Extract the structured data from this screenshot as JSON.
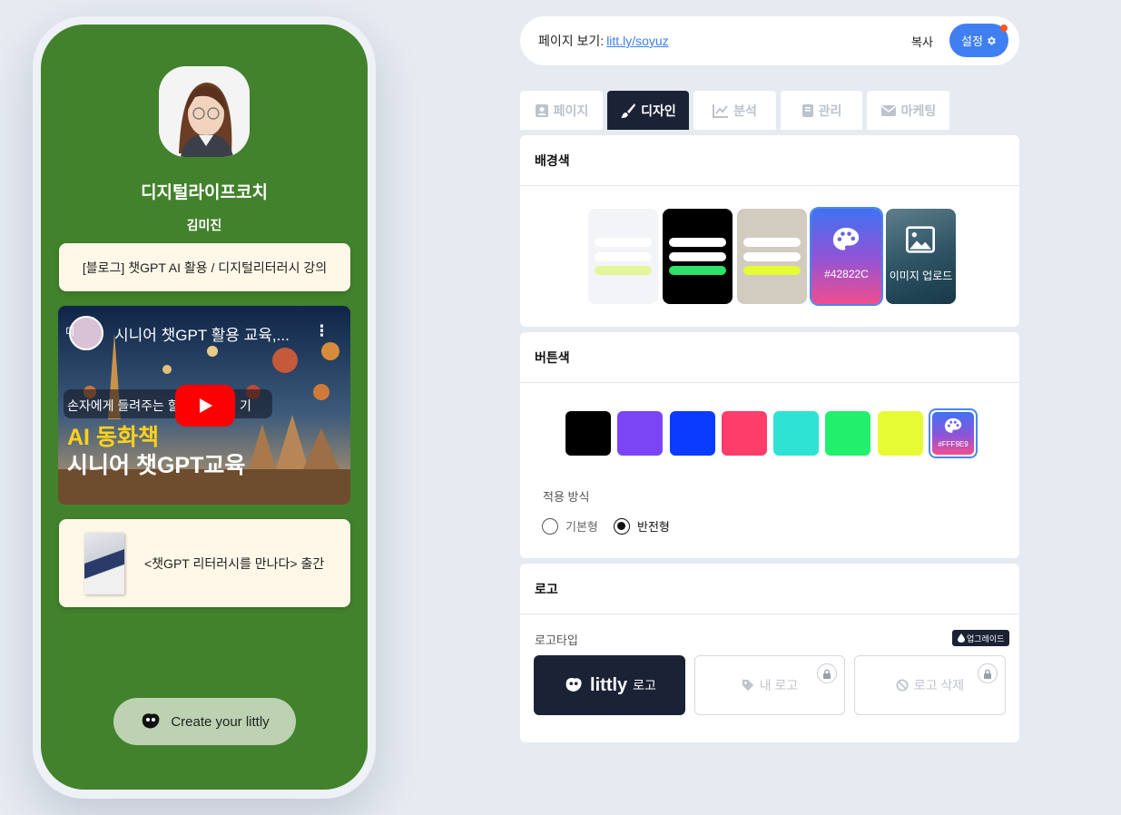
{
  "preview": {
    "title": "디지털라이프코치",
    "name": "김미진",
    "links": [
      {
        "label": "[블로그] 챗GPT AI 활용 / 디지털리터러시 강의"
      },
      {
        "label": "<챗GPT 리터러시를 만나다> 출간"
      }
    ],
    "video": {
      "title": "시니어 챗GPT 활용 교육,...",
      "channel_hint": "디",
      "subtitle": "손자에게 들려주는 할",
      "subtitle_tail": "기",
      "headline_1": "AI 동화책",
      "headline_2": "시니어 챗GPT교육"
    },
    "create_button": "Create your littly",
    "background_color": "#42822c"
  },
  "topbar": {
    "view_label": "페이지 보기:",
    "view_link": "litt.ly/soyuz",
    "copy_label": "복사",
    "settings_label": "설정"
  },
  "tabs": [
    {
      "label": "페이지",
      "icon": "id-card-icon",
      "active": false
    },
    {
      "label": "디자인",
      "icon": "brush-icon",
      "active": true
    },
    {
      "label": "분석",
      "icon": "chart-line-icon",
      "active": false
    },
    {
      "label": "관리",
      "icon": "book-icon",
      "active": false
    },
    {
      "label": "마케팅",
      "icon": "envelope-icon",
      "active": false
    }
  ],
  "background_section": {
    "title": "배경색",
    "custom_color_label": "#42822C",
    "upload_label": "이미지 업로드"
  },
  "button_section": {
    "title": "버튼색",
    "swatches": [
      "#000000",
      "#7b45f5",
      "#0a3bff",
      "#ff3d6a",
      "#2fe3d4",
      "#22f06d",
      "#e7fb34"
    ],
    "custom_color_label": "#FFF9E9",
    "apply_label": "적용 방식",
    "options": [
      {
        "label": "기본형",
        "checked": false
      },
      {
        "label": "반전형",
        "checked": true
      }
    ]
  },
  "logo_section": {
    "title": "로고",
    "type_label": "로고타입",
    "upgrade_label": "업그레이드",
    "options": {
      "littly_brand": "littly",
      "littly_suffix": "로고",
      "my_logo": "내 로고",
      "remove_logo": "로고 삭제"
    }
  },
  "colors": {
    "accent": "#3f7ff2",
    "dark": "#1b2236"
  }
}
